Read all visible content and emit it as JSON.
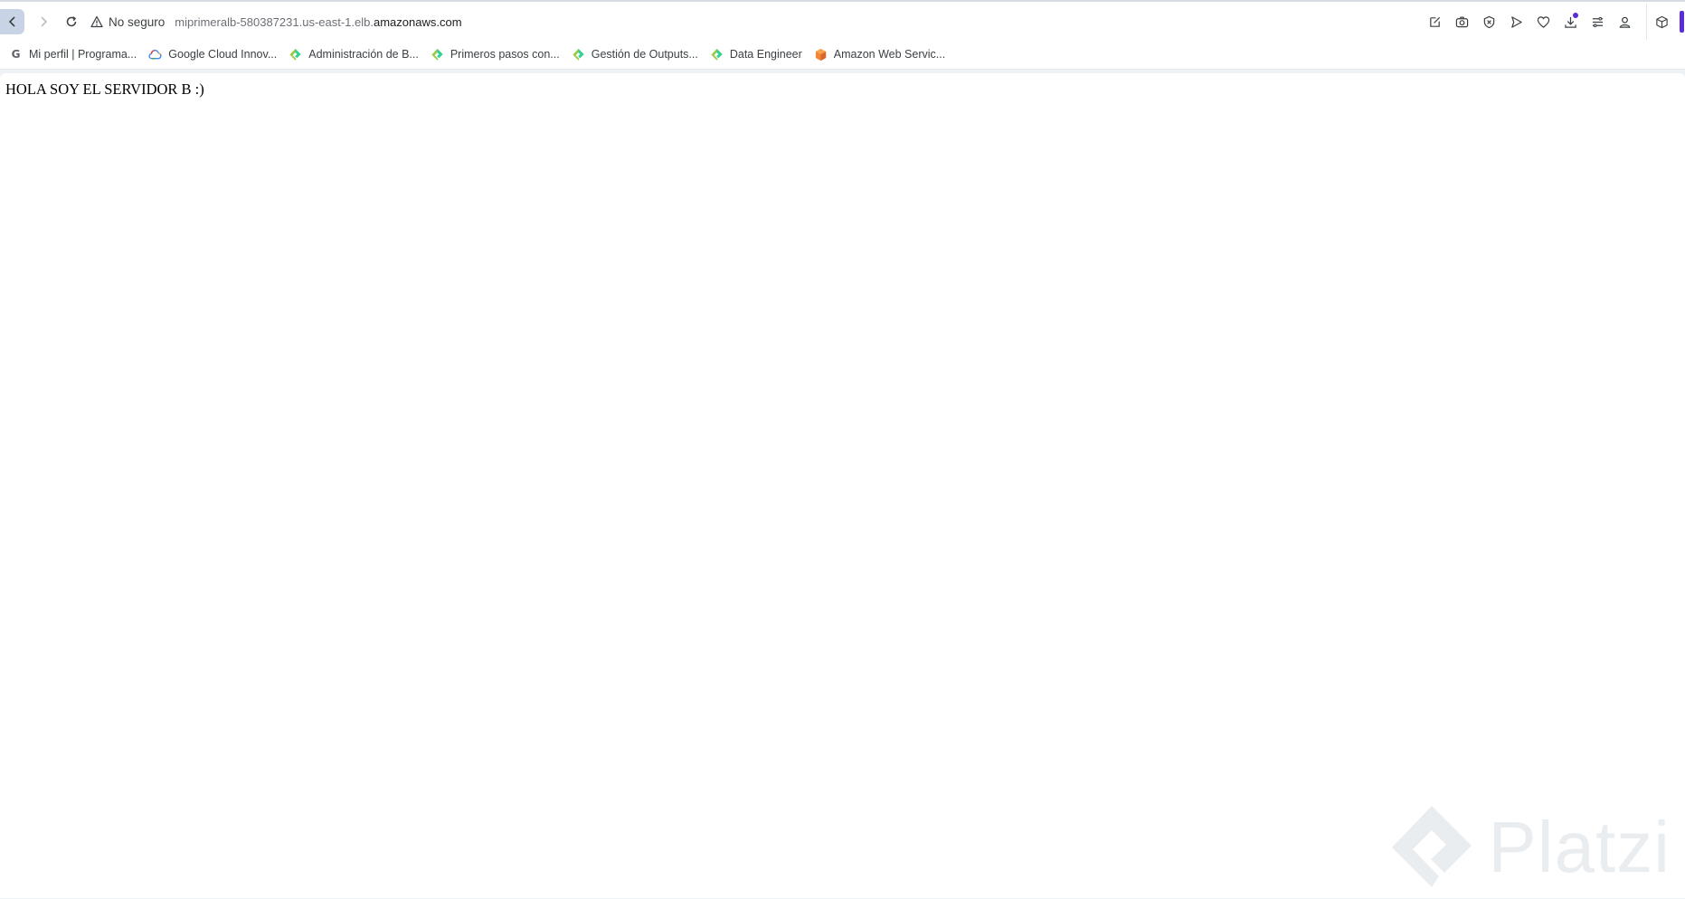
{
  "address_bar": {
    "security_label": "No seguro",
    "url_prefix": "miprimeralb-580387231.us-east-1.elb.",
    "url_host": "amazonaws.com"
  },
  "toolbar": {
    "icons": [
      "edit-icon",
      "camera-icon",
      "shield-x-icon",
      "send-icon",
      "heart-icon",
      "download-icon",
      "menu-icon",
      "profile-icon"
    ],
    "sidebar_icon": "cube-icon",
    "accent_color": "#5b2bd9"
  },
  "bookmarks": [
    {
      "label": "Mi perfil | Programa...",
      "icon": "google-g-icon"
    },
    {
      "label": "Google Cloud Innov...",
      "icon": "google-cloud-icon"
    },
    {
      "label": "Administración de B...",
      "icon": "platzi-icon"
    },
    {
      "label": "Primeros pasos con...",
      "icon": "platzi-icon"
    },
    {
      "label": "Gestión de Outputs...",
      "icon": "platzi-icon"
    },
    {
      "label": "Data Engineer",
      "icon": "platzi-icon"
    },
    {
      "label": "Amazon Web Servic...",
      "icon": "aws-cube-icon"
    }
  ],
  "page": {
    "body_text": "HOLA SOY EL SERVIDOR B :)"
  },
  "watermark": {
    "text": "Platzi"
  }
}
